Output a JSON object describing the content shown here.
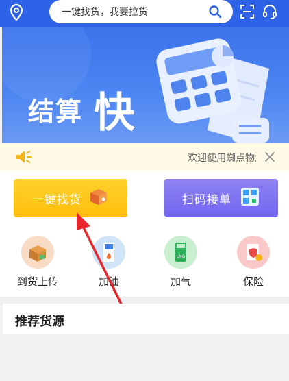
{
  "header": {
    "search_placeholder": "一键找货，我要拉货",
    "location_icon": "location-pin-icon",
    "search_icon": "search-icon",
    "scan_icon": "scan-icon",
    "service_icon": "headset-icon",
    "bg_color": "#2e63e8"
  },
  "banner": {
    "title": "结算",
    "title_emphasis": "快",
    "dots_count": 4,
    "active_dot": 2
  },
  "notice": {
    "text": "欢迎使用蜘点物流",
    "speaker_icon": "speaker-icon",
    "close_icon": "close-icon"
  },
  "actions": [
    {
      "label": "一键找货",
      "icon": "box-icon",
      "color": "#ffc61a"
    },
    {
      "label": "扫码接单",
      "icon": "qrcode-icon",
      "color": "#7d71f0"
    }
  ],
  "services": [
    {
      "label": "到货上传",
      "icon": "cargo-box-icon",
      "color": "#f9dcc5"
    },
    {
      "label": "加油",
      "icon": "fuel-pump-icon",
      "color": "#cfe4f7"
    },
    {
      "label": "加气",
      "icon": "lng-pump-icon",
      "color": "#c8efcf"
    },
    {
      "label": "保险",
      "icon": "insurance-icon",
      "color": "#f9c9c9"
    }
  ],
  "section": {
    "title": "推荐货源"
  }
}
